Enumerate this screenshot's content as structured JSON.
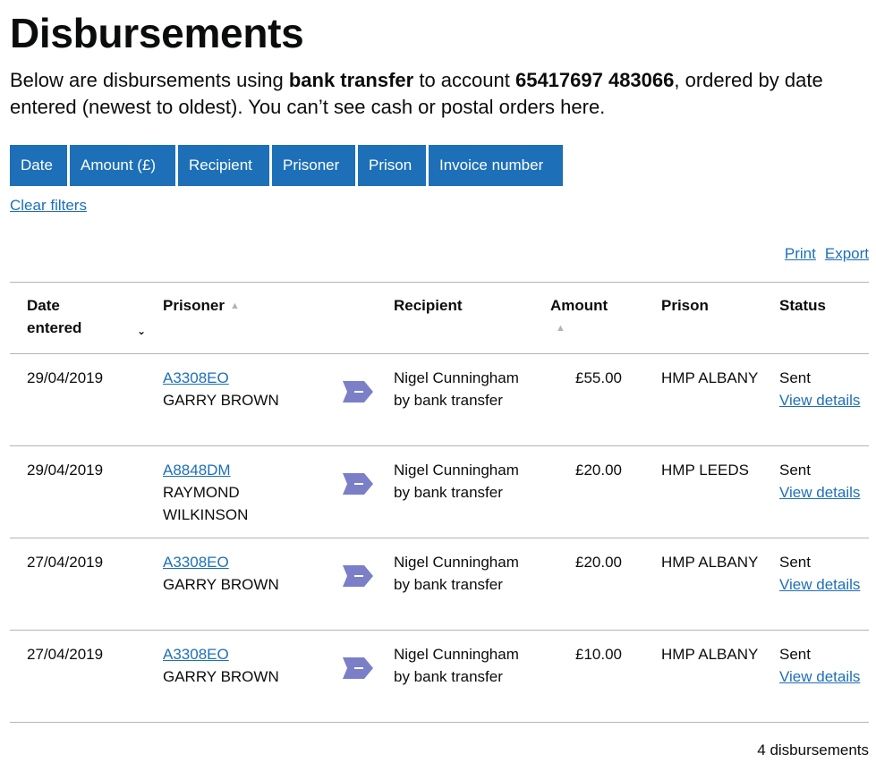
{
  "page": {
    "title": "Disbursements",
    "intro_prefix": "Below are disbursements using ",
    "intro_bold_1": "bank transfer",
    "intro_middle": " to account ",
    "intro_bold_2": "65417697 483066",
    "intro_suffix": ", ordered by date entered (newest to oldest). You can’t see cash or postal orders here."
  },
  "filters": [
    "Date",
    "Amount (£)",
    "Recipient",
    "Prisoner",
    "Prison",
    "Invoice number"
  ],
  "clear_filters": "Clear filters",
  "actions": {
    "print": "Print",
    "export": "Export"
  },
  "table": {
    "headers": {
      "date_line1": "Date",
      "date_line2": "entered",
      "prisoner": "Prisoner",
      "recipient": "Recipient",
      "amount": "Amount",
      "prison": "Prison",
      "status": "Status"
    },
    "rows": [
      {
        "date": "29/04/2019",
        "prisoner_number": "A3308EO",
        "prisoner_name": "GARRY BROWN",
        "recipient_name": "Nigel Cunningham",
        "recipient_method": "by bank transfer",
        "amount": "£55.00",
        "prison": "HMP ALBANY",
        "status": "Sent",
        "status_link": "View details"
      },
      {
        "date": "29/04/2019",
        "prisoner_number": "A8848DM",
        "prisoner_name": "RAYMOND WILKINSON",
        "recipient_name": "Nigel Cunningham",
        "recipient_method": "by bank transfer",
        "amount": "£20.00",
        "prison": "HMP LEEDS",
        "status": "Sent",
        "status_link": "View details"
      },
      {
        "date": "27/04/2019",
        "prisoner_number": "A3308EO",
        "prisoner_name": "GARRY BROWN",
        "recipient_name": "Nigel Cunningham",
        "recipient_method": "by bank transfer",
        "amount": "£20.00",
        "prison": "HMP ALBANY",
        "status": "Sent",
        "status_link": "View details"
      },
      {
        "date": "27/04/2019",
        "prisoner_number": "A3308EO",
        "prisoner_name": "GARRY BROWN",
        "recipient_name": "Nigel Cunningham",
        "recipient_method": "by bank transfer",
        "amount": "£10.00",
        "prison": "HMP ALBANY",
        "status": "Sent",
        "status_link": "View details"
      }
    ]
  },
  "footer": {
    "count": "4 disbursements"
  },
  "colors": {
    "link": "#1d70b8",
    "button": "#1d70b8",
    "arrow": "#7b7fc7",
    "border": "#b1b4b6"
  },
  "icons": {
    "sort_default": "sort-icon",
    "sort_active": "chevron-down-icon",
    "transfer": "arrow-tag-icon"
  }
}
